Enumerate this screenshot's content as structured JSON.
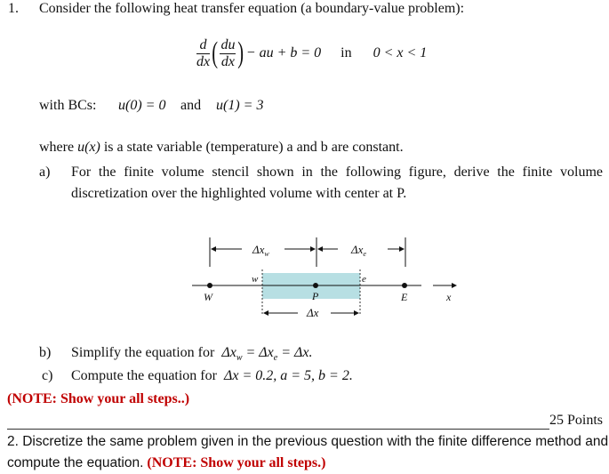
{
  "question1": {
    "number": "1.",
    "intro": "Consider the following heat transfer equation (a boundary-value problem):",
    "equation": {
      "d_num": "d",
      "d_den": "dx",
      "du_num": "du",
      "du_den": "dx",
      "rest": "− au + b = 0",
      "in_word": "in",
      "domain": "0 < x < 1"
    },
    "bcs": {
      "label": "with BCs:",
      "bc1": "u(0) = 0",
      "and_word": "and",
      "bc2": "u(1) = 3"
    },
    "where_text_pre": "where",
    "where_var": "u(x)",
    "where_text_post": "is a state variable (temperature) a and b are constant.",
    "part_a": {
      "label": "a)",
      "line1": "For the finite volume stencil shown in the following figure, derive the finite volume",
      "line2": "discretization over the highlighted volume with center at P."
    },
    "figure": {
      "dx_w": "Δx",
      "dx_w_sub": "w",
      "dx_e": "Δx",
      "dx_e_sub": "e",
      "face_w": "w",
      "face_e": "e",
      "node_W": "W",
      "node_P": "P",
      "node_E": "E",
      "axis_label": "x",
      "dx": "Δx",
      "highlight_color": "#b7dfe3"
    },
    "part_b": {
      "label": "b)",
      "text": "Simplify the equation for",
      "math": "Δx_w = Δx_e = Δx."
    },
    "part_c": {
      "label": "c)",
      "text": "Compute the equation for",
      "math": "Δx = 0.2,  a = 5,  b = 2."
    },
    "note": "(NOTE: Show your all steps..)",
    "points": "25 Points"
  },
  "question2": {
    "text_line1": "2. Discretize the same problem given in the previous question with the finite difference method and",
    "text_line2": "compute the equation.",
    "note": "(NOTE: Show your all steps.)"
  },
  "colors": {
    "note_red": "#c00000",
    "highlight": "#b7dfe3"
  }
}
